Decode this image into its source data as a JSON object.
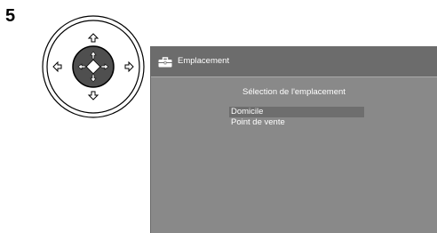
{
  "step": {
    "number": "5"
  },
  "remote": {
    "center_icon": "enter-cross-icon",
    "directions": [
      "up-arrow-icon",
      "down-arrow-icon",
      "left-arrow-icon",
      "right-arrow-icon"
    ]
  },
  "screen": {
    "title_icon": "toolbox-icon",
    "title": "Emplacement",
    "heading": "Sélection de l'emplacement",
    "options": [
      {
        "label": "Domicile",
        "selected": true
      },
      {
        "label": "Point de vente",
        "selected": false
      }
    ],
    "colors": {
      "background": "#898989",
      "title_bar": "#6c6c6c",
      "highlight": "#6e6e6e",
      "text": "#ffffff"
    }
  }
}
